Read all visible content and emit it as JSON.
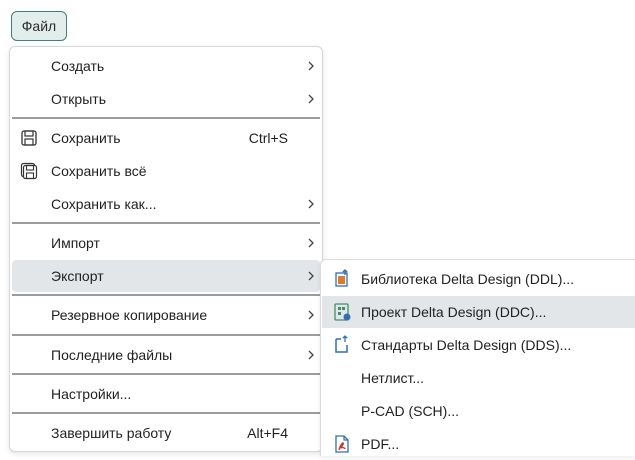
{
  "file_button": {
    "label": "Файл"
  },
  "menu": {
    "create": {
      "label": "Создать"
    },
    "open": {
      "label": "Открыть"
    },
    "save": {
      "label": "Сохранить",
      "shortcut": "Ctrl+S",
      "icon": "floppy-disk-icon"
    },
    "save_all": {
      "label": "Сохранить всё",
      "icon": "floppy-disks-icon"
    },
    "save_as": {
      "label": "Сохранить как..."
    },
    "import": {
      "label": "Импорт"
    },
    "export": {
      "label": "Экспорт",
      "highlighted": true
    },
    "backup": {
      "label": "Резервное копирование"
    },
    "recent": {
      "label": "Последние файлы"
    },
    "settings": {
      "label": "Настройки..."
    },
    "exit": {
      "label": "Завершить работу",
      "shortcut": "Alt+F4"
    }
  },
  "export_submenu": {
    "ddl": {
      "label": "Библиотека Delta Design (DDL)...",
      "icon": "library-export-icon"
    },
    "ddc": {
      "label": "Проект Delta Design (DDC)...",
      "icon": "project-export-icon",
      "highlighted": true
    },
    "dds": {
      "label": "Стандарты Delta Design (DDS)...",
      "icon": "standards-export-icon"
    },
    "netlist": {
      "label": "Нетлист..."
    },
    "pcad": {
      "label": "P-CAD (SCH)..."
    },
    "pdf": {
      "label": "PDF...",
      "icon": "pdf-icon"
    }
  },
  "colors": {
    "accent_border": "#3f7f7c",
    "highlight": "#e3e6e9",
    "icon_orange": "#e07b2e",
    "icon_blue": "#2f6fb6",
    "icon_green": "#3f8f6a",
    "pdf_red": "#d0342c"
  }
}
